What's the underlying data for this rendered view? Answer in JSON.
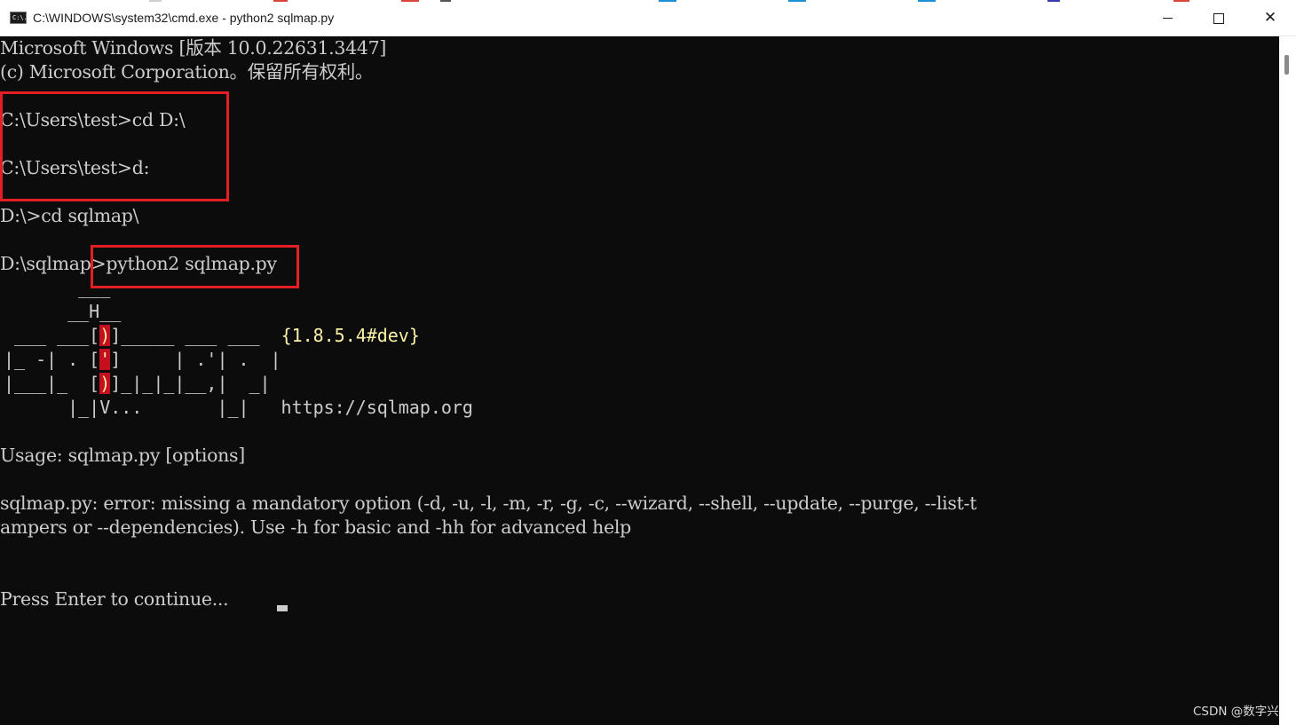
{
  "window": {
    "icon": "cmd-icon",
    "icon_text": "C:\\.",
    "title": "C:\\WINDOWS\\system32\\cmd.exe - python2  sqlmap.py",
    "buttons": {
      "minimize": "minimize-icon",
      "maximize": "maximize-icon",
      "close": "close-icon"
    },
    "close_glyph": "✕"
  },
  "console": {
    "lines": [
      "Microsoft Windows [版本 10.0.22631.3447]",
      "(c) Microsoft Corporation。保留所有权利。",
      "C:\\Users\\test>cd D:\\",
      "C:\\Users\\test>d:",
      "D:\\>cd sqlmap\\",
      "D:\\sqlmap>python2 sqlmap.py"
    ],
    "logo": {
      "l1": "       ___",
      "l2a": "      __H__",
      "l3a": " ___ ___[",
      "l3b": ")",
      "l3c": "]_____ ___ ___",
      "l3v": "  {1.8.5.4#dev}",
      "l4a": "|_ -| . [",
      "l4b": "'",
      "l4c": "]     | .'| .  |",
      "l5a": "|___|_  [",
      "l5b": ")",
      "l5c": "]_|_|_|__,|  _|",
      "l6": "      |_|V...       |_|",
      "l6u": "   https://sqlmap.org"
    },
    "usage": "Usage: sqlmap.py [options]",
    "error_line1": "sqlmap.py: error: missing a mandatory option (-d, -u, -l, -m, -r, -g, -c, --wizard, --shell, --update, --purge, --list-t",
    "error_line2": "ampers or --dependencies). Use -h for basic and -hh for advanced help",
    "prompt": "Press Enter to continue..."
  },
  "colors": {
    "background": "#0c0c0c",
    "text": "#cccccc",
    "version_yellow": "#f9f1a5",
    "annotation_red": "#e51e25"
  },
  "watermark": "CSDN @数字兴"
}
